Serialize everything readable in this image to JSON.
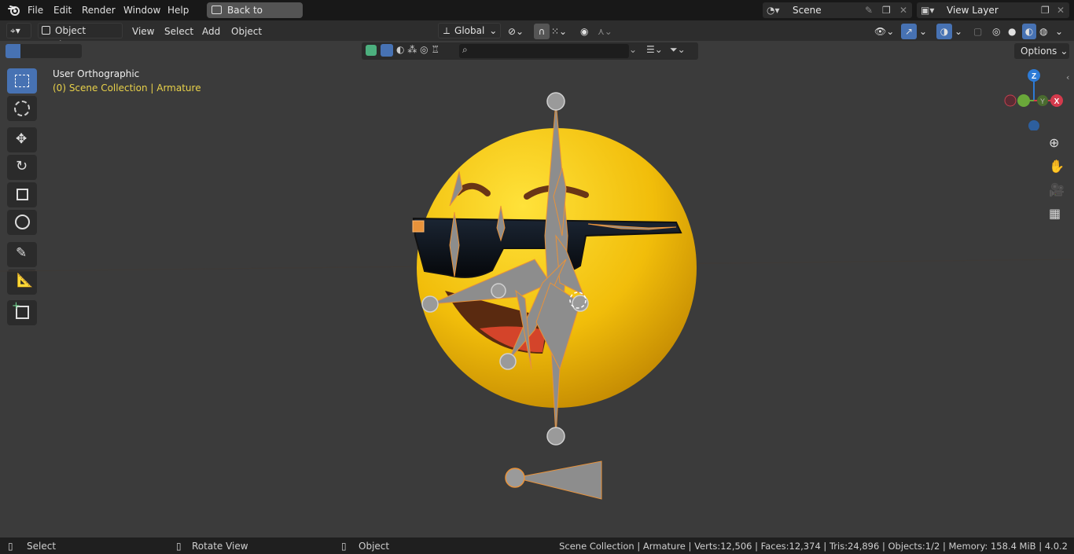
{
  "menu": {
    "items": [
      "File",
      "Edit",
      "Render",
      "Window",
      "Help"
    ],
    "back_button": "Back to Previous"
  },
  "scene": {
    "label": "Scene"
  },
  "view_layer": {
    "label": "View Layer"
  },
  "header": {
    "mode": "Object Mode",
    "menus": [
      "View",
      "Select",
      "Add",
      "Object"
    ],
    "transform_orientation": "Global",
    "options": "Options"
  },
  "viewport": {
    "view_name": "User Orthographic",
    "collection_info": "(0) Scene Collection | Armature"
  },
  "gizmo": {
    "z": "Z",
    "x": "X",
    "y": "Y"
  },
  "status": {
    "select": "Select",
    "rotate": "Rotate View",
    "object": "Object",
    "stats": "Scene Collection | Armature | Verts:12,506 | Faces:12,374 | Tris:24,896 | Objects:1/2 | Memory: 158.4 MiB | 4.0.2"
  },
  "colors": {
    "accent": "#4772b3",
    "selection_orange": "#e8923a",
    "info_yellow": "#e8d14a"
  }
}
